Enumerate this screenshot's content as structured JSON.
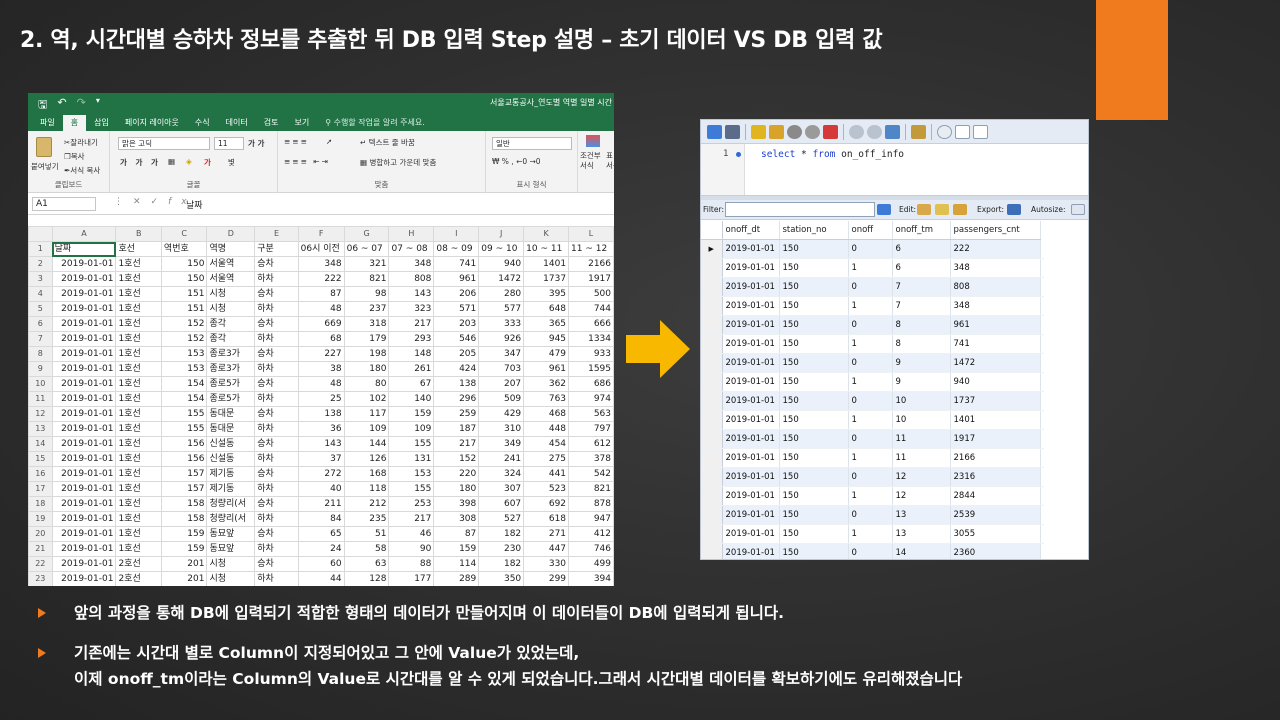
{
  "slide": {
    "title": "2. 역, 시간대별 승하차 정보를 추출한 뒤 DB 입력 Step 설명 – 초기 데이터 VS DB 입력 값",
    "accent_color": "#ef7b1e",
    "bullets": [
      {
        "lines": [
          "앞의 과정을 통해 DB에 입력되기 적합한 형태의 데이터가 만들어지며 이 데이터들이 DB에 입력되게 됩니다."
        ]
      },
      {
        "lines": [
          "기존에는 시간대 별로 Column이 지정되어있고 그 안에 Value가 있었는데,",
          "이제 onoff_tm이라는 Column의 Value로 시간대를 알 수 있게 되었습니다.그래서 시간대별 데이터를 확보하기에도 유리해졌습니다"
        ]
      }
    ]
  },
  "excel": {
    "doc_title": "서울교통공사_연도별 역별 일별 시간",
    "accent_color": "#217346",
    "tabs": [
      "파일",
      "홈",
      "삽입",
      "페이지 레이아웃",
      "수식",
      "데이터",
      "검토",
      "보기"
    ],
    "active_tab": "홈",
    "tell_me": "수행할 작업을 알려 주세요.",
    "ribbon": {
      "paste": "붙여넣기",
      "cut": "잘라내기",
      "copy": "복사",
      "format_painter": "서식 복사",
      "font_name": "맑은 고딕",
      "font_size": "11",
      "wrap_text": "텍스트 줄 바꿈",
      "merge_center": "병합하고 가운데 맞춤",
      "number_format": "일반",
      "conditional": "조건부",
      "conditional2": "서식",
      "table_fmt": "표",
      "table_fmt2": "서식",
      "groups": [
        "클립보드",
        "글꼴",
        "맞춤",
        "표시 형식"
      ]
    },
    "name_box": "A1",
    "formula_value": "날짜",
    "columns": [
      "A",
      "B",
      "C",
      "D",
      "E",
      "F",
      "G",
      "H",
      "I",
      "J",
      "K",
      "L"
    ],
    "header_row": [
      "날짜",
      "호선",
      "역번호",
      "역명",
      "구분",
      "06시 이전",
      "06 ~ 07",
      "07 ~ 08",
      "08 ~ 09",
      "09 ~ 10",
      "10 ~ 11",
      "11 ~ 12"
    ],
    "rows": [
      [
        "2019-01-01",
        "1호선",
        "150",
        "서울역",
        "승차",
        "348",
        "321",
        "348",
        "741",
        "940",
        "1401",
        "2166"
      ],
      [
        "2019-01-01",
        "1호선",
        "150",
        "서울역",
        "하차",
        "222",
        "821",
        "808",
        "961",
        "1472",
        "1737",
        "1917"
      ],
      [
        "2019-01-01",
        "1호선",
        "151",
        "시청",
        "승차",
        "87",
        "98",
        "143",
        "206",
        "280",
        "395",
        "500"
      ],
      [
        "2019-01-01",
        "1호선",
        "151",
        "시청",
        "하차",
        "48",
        "237",
        "323",
        "571",
        "577",
        "648",
        "744"
      ],
      [
        "2019-01-01",
        "1호선",
        "152",
        "종각",
        "승차",
        "669",
        "318",
        "217",
        "203",
        "333",
        "365",
        "666"
      ],
      [
        "2019-01-01",
        "1호선",
        "152",
        "종각",
        "하차",
        "68",
        "179",
        "293",
        "546",
        "926",
        "945",
        "1334"
      ],
      [
        "2019-01-01",
        "1호선",
        "153",
        "종로3가",
        "승차",
        "227",
        "198",
        "148",
        "205",
        "347",
        "479",
        "933"
      ],
      [
        "2019-01-01",
        "1호선",
        "153",
        "종로3가",
        "하차",
        "38",
        "180",
        "261",
        "424",
        "703",
        "961",
        "1595"
      ],
      [
        "2019-01-01",
        "1호선",
        "154",
        "종로5가",
        "승차",
        "48",
        "80",
        "67",
        "138",
        "207",
        "362",
        "686"
      ],
      [
        "2019-01-01",
        "1호선",
        "154",
        "종로5가",
        "하차",
        "25",
        "102",
        "140",
        "296",
        "509",
        "763",
        "974"
      ],
      [
        "2019-01-01",
        "1호선",
        "155",
        "동대문",
        "승차",
        "138",
        "117",
        "159",
        "259",
        "429",
        "468",
        "563"
      ],
      [
        "2019-01-01",
        "1호선",
        "155",
        "동대문",
        "하차",
        "36",
        "109",
        "109",
        "187",
        "310",
        "448",
        "797"
      ],
      [
        "2019-01-01",
        "1호선",
        "156",
        "신설동",
        "승차",
        "143",
        "144",
        "155",
        "217",
        "349",
        "454",
        "612"
      ],
      [
        "2019-01-01",
        "1호선",
        "156",
        "신설동",
        "하차",
        "37",
        "126",
        "131",
        "152",
        "241",
        "275",
        "378"
      ],
      [
        "2019-01-01",
        "1호선",
        "157",
        "제기동",
        "승차",
        "272",
        "168",
        "153",
        "220",
        "324",
        "441",
        "542"
      ],
      [
        "2019-01-01",
        "1호선",
        "157",
        "제기동",
        "하차",
        "40",
        "118",
        "155",
        "180",
        "307",
        "523",
        "821"
      ],
      [
        "2019-01-01",
        "1호선",
        "158",
        "청량리(서",
        "승차",
        "211",
        "212",
        "253",
        "398",
        "607",
        "692",
        "878"
      ],
      [
        "2019-01-01",
        "1호선",
        "158",
        "청량리(서",
        "하차",
        "84",
        "235",
        "217",
        "308",
        "527",
        "618",
        "947"
      ],
      [
        "2019-01-01",
        "1호선",
        "159",
        "동묘앞",
        "승차",
        "65",
        "51",
        "46",
        "87",
        "182",
        "271",
        "412"
      ],
      [
        "2019-01-01",
        "1호선",
        "159",
        "동묘앞",
        "하차",
        "24",
        "58",
        "90",
        "159",
        "230",
        "447",
        "746"
      ],
      [
        "2019-01-01",
        "2호선",
        "201",
        "시청",
        "승차",
        "60",
        "63",
        "88",
        "114",
        "182",
        "330",
        "499"
      ],
      [
        "2019-01-01",
        "2호선",
        "201",
        "시청",
        "하차",
        "44",
        "128",
        "177",
        "289",
        "350",
        "299",
        "394"
      ]
    ]
  },
  "heidi": {
    "line_no": "1",
    "sql_kw1": "select",
    "sql_mid": " * ",
    "sql_kw2": "from",
    "sql_table": " on_off_info",
    "filter_label": "Filter:",
    "edit_label": "Edit:",
    "export_label": "Export:",
    "autosize_label": "Autosize:",
    "columns": [
      "onoff_dt",
      "station_no",
      "onoff",
      "onoff_tm",
      "passengers_cnt"
    ],
    "rows": [
      [
        "2019-01-01",
        "150",
        "0",
        "6",
        "222"
      ],
      [
        "2019-01-01",
        "150",
        "1",
        "6",
        "348"
      ],
      [
        "2019-01-01",
        "150",
        "0",
        "7",
        "808"
      ],
      [
        "2019-01-01",
        "150",
        "1",
        "7",
        "348"
      ],
      [
        "2019-01-01",
        "150",
        "0",
        "8",
        "961"
      ],
      [
        "2019-01-01",
        "150",
        "1",
        "8",
        "741"
      ],
      [
        "2019-01-01",
        "150",
        "0",
        "9",
        "1472"
      ],
      [
        "2019-01-01",
        "150",
        "1",
        "9",
        "940"
      ],
      [
        "2019-01-01",
        "150",
        "0",
        "10",
        "1737"
      ],
      [
        "2019-01-01",
        "150",
        "1",
        "10",
        "1401"
      ],
      [
        "2019-01-01",
        "150",
        "0",
        "11",
        "1917"
      ],
      [
        "2019-01-01",
        "150",
        "1",
        "11",
        "2166"
      ],
      [
        "2019-01-01",
        "150",
        "0",
        "12",
        "2316"
      ],
      [
        "2019-01-01",
        "150",
        "1",
        "12",
        "2844"
      ],
      [
        "2019-01-01",
        "150",
        "0",
        "13",
        "2539"
      ],
      [
        "2019-01-01",
        "150",
        "1",
        "13",
        "3055"
      ],
      [
        "2019-01-01",
        "150",
        "0",
        "14",
        "2360"
      ]
    ]
  },
  "arrow_color": "#f9b800"
}
